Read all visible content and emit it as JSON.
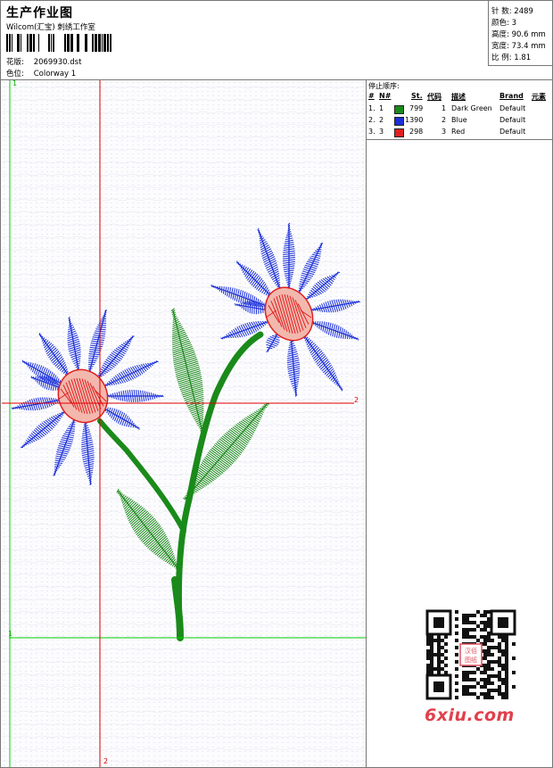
{
  "header": {
    "title": "生产作业图",
    "company": "Wilcom(汇宝) 刺绣工作室",
    "design_label": "花版:",
    "design_value": "2069930.dst",
    "colorway_label": "色位:",
    "colorway_value": "Colorway 1"
  },
  "stats": {
    "stitches_label": "针 数:",
    "stitches_value": "2489",
    "colors_label": "颜色:",
    "colors_value": "3",
    "height_label": "高度:",
    "height_value": "90.6 mm",
    "width_label": "宽度:",
    "width_value": "73.4 mm",
    "ratio_label": "比 例:",
    "ratio_value": "1.81"
  },
  "stop_sequence": {
    "heading": "停止顺序:",
    "columns": {
      "num": "#",
      "needle": "N#",
      "st": "St.",
      "code": "代码",
      "desc": "描述",
      "brand": "Brand",
      "element": "元素"
    },
    "rows": [
      {
        "num": "1.",
        "needle": "1",
        "color": "#1a8a1a",
        "st": "799",
        "code": "1",
        "desc": "Dark Green",
        "brand": "Default"
      },
      {
        "num": "2.",
        "needle": "2",
        "color": "#1a2fd8",
        "st": "1390",
        "code": "2",
        "desc": "Blue",
        "brand": "Default"
      },
      {
        "num": "3.",
        "needle": "3",
        "color": "#e02020",
        "st": "298",
        "code": "3",
        "desc": "Red",
        "brand": "Default"
      }
    ]
  },
  "axes": {
    "green_top": "1",
    "green_left": "1",
    "red_right": "2",
    "red_bottom": "2"
  },
  "logo": "6xiu.com",
  "qr_text": "汉佰图纸",
  "colors": {
    "green": "#1a8a1a",
    "blue": "#1a2fd8",
    "red": "#e02020",
    "guide_green": "#00d000",
    "guide_red": "#e00000"
  }
}
